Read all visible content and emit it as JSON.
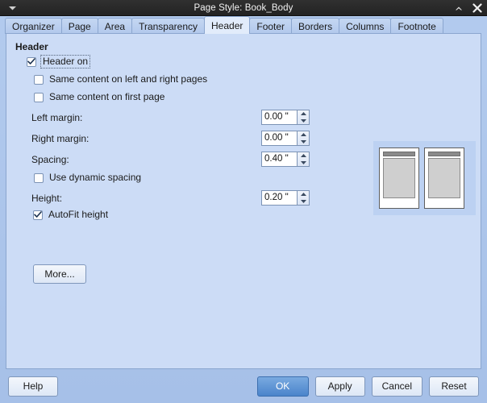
{
  "window": {
    "title": "Page Style: Book_Body",
    "menu_icon": "menu-arrow-icon",
    "restore_icon": "restore-icon",
    "close_icon": "close-icon"
  },
  "tabs": [
    {
      "label": "Organizer",
      "active": false
    },
    {
      "label": "Page",
      "active": false
    },
    {
      "label": "Area",
      "active": false
    },
    {
      "label": "Transparency",
      "active": false
    },
    {
      "label": "Header",
      "active": true
    },
    {
      "label": "Footer",
      "active": false
    },
    {
      "label": "Borders",
      "active": false
    },
    {
      "label": "Columns",
      "active": false
    },
    {
      "label": "Footnote",
      "active": false
    }
  ],
  "header_panel": {
    "group_title": "Header",
    "checkboxes": {
      "header_on": {
        "label": "Header on",
        "checked": true,
        "focused": true
      },
      "same_left_right": {
        "label": "Same content on left and right pages",
        "checked": false
      },
      "same_first": {
        "label": "Same content on first page",
        "checked": false
      },
      "dynamic_spacing": {
        "label": "Use dynamic spacing",
        "checked": false
      },
      "autofit_height": {
        "label": "AutoFit height",
        "checked": true
      }
    },
    "fields": {
      "left_margin": {
        "label": "Left margin:",
        "value": "0.00 \""
      },
      "right_margin": {
        "label": "Right margin:",
        "value": "0.00 \""
      },
      "spacing": {
        "label": "Spacing:",
        "value": "0.40 \""
      },
      "height": {
        "label": "Height:",
        "value": "0.20 \""
      }
    },
    "more_button": "More..."
  },
  "footer": {
    "help": "Help",
    "ok": "OK",
    "apply": "Apply",
    "cancel": "Cancel",
    "reset": "Reset"
  },
  "colors": {
    "dialog_bg": "#a8c3ea",
    "panel_bg": "#ccdcf6",
    "titlebar_bg": "#2a2a2a",
    "accent_primary": "#4a84cb",
    "tab_active_bg": "#e2ecfb",
    "preview_bg": "#bcd1f2"
  }
}
